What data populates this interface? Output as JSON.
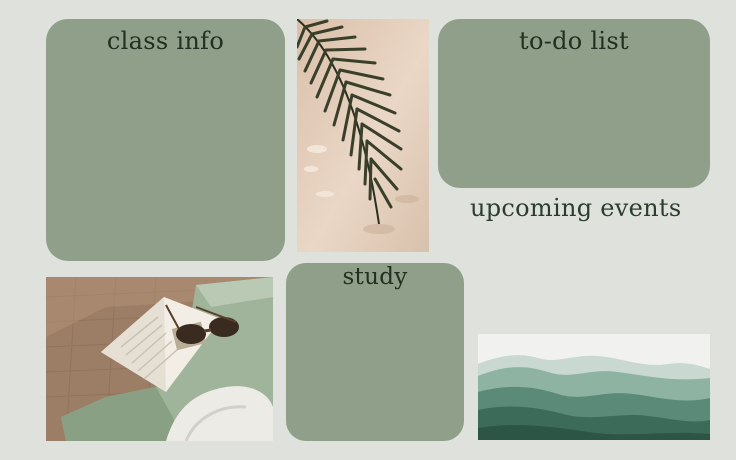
{
  "board": {
    "class_info": {
      "title": "class info"
    },
    "todo": {
      "title": "to-do list"
    },
    "study": {
      "title": "study"
    },
    "upcoming": {
      "title": "upcoming events"
    }
  },
  "colors": {
    "background": "#dfe2dc",
    "card": "#8f9f8a",
    "title_text": "#203021"
  },
  "images": {
    "palm": "palm-leaf-shadow-photo",
    "lounge": "sunglasses-magazine-lounge-chair-photo",
    "mountains": "green-watercolor-mountains-art"
  }
}
